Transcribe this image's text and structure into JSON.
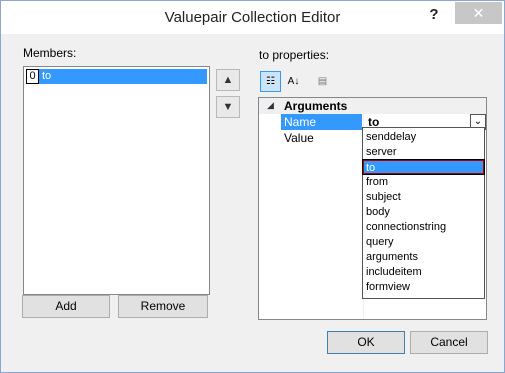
{
  "window": {
    "title": "Valuepair Collection Editor",
    "help_glyph": "?",
    "close_glyph": "✕"
  },
  "members": {
    "label": "Members:",
    "items": [
      {
        "index": "0",
        "name": "to"
      }
    ],
    "up_glyph": "▲",
    "down_glyph": "▼",
    "add_label": "Add",
    "remove_label": "Remove"
  },
  "properties": {
    "label": "to properties:",
    "toolbar": {
      "categorized_glyph": "☷",
      "alpha_glyph": "A↓",
      "pages_glyph": "▤"
    },
    "category": "Arguments",
    "rows": [
      {
        "name": "Name",
        "value": "to"
      },
      {
        "name": "Value",
        "value": ""
      }
    ],
    "dropdown_glyph": "⌄",
    "dropdown_options": [
      "senddelay",
      "server",
      "to",
      "from",
      "subject",
      "body",
      "connectionstring",
      "query",
      "arguments",
      "includeitem",
      "formview"
    ],
    "dropdown_selected": "to"
  },
  "buttons": {
    "ok_label": "OK",
    "cancel_label": "Cancel"
  }
}
